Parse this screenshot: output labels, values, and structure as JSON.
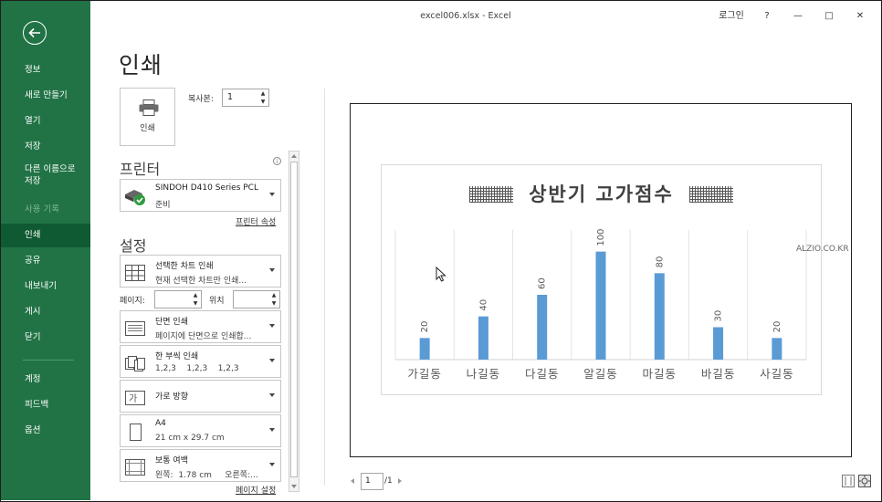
{
  "window": {
    "title": "excel006.xlsx  -  Excel",
    "signin_label": "로그인",
    "help_label": "?",
    "minimize_label": "—",
    "maximize_label": "□",
    "close_label": "✕"
  },
  "sidebar": {
    "items": [
      {
        "label": "정보"
      },
      {
        "label": "새로 만들기"
      },
      {
        "label": "열기"
      },
      {
        "label": "저장"
      },
      {
        "label": "다른 이름으로 저장"
      },
      {
        "label": "사용 기록"
      },
      {
        "label": "인쇄"
      },
      {
        "label": "공유"
      },
      {
        "label": "내보내기"
      },
      {
        "label": "게시"
      },
      {
        "label": "닫기"
      },
      {
        "label": "계정"
      },
      {
        "label": "피드백"
      },
      {
        "label": "옵션"
      }
    ],
    "active": "인쇄",
    "accent": "#217346"
  },
  "print": {
    "heading": "인쇄",
    "print_button_label": "인쇄",
    "copies_label": "복사본:",
    "copies_value": "1",
    "printer_section": "프린터",
    "printer_name": "SINDOH D410 Series PCL",
    "printer_status": "준비",
    "printer_properties_link": "프린터 속성",
    "settings_section": "설정",
    "settings": [
      {
        "line1": "선택한 차트 인쇄",
        "line2": "현재 선택한 차트만 인쇄..."
      },
      {
        "line1": "단면 인쇄",
        "line2": "페이지에 단면으로 인쇄합..."
      },
      {
        "line1": "한 부씩 인쇄",
        "line2": "1,2,3    1,2,3    1,2,3"
      },
      {
        "line1": "가로 방향",
        "line2": ""
      },
      {
        "line1": "A4",
        "line2": "21 cm x 29.7 cm"
      },
      {
        "line1": "보통 여백",
        "line2": "왼쪽:  1.78 cm     오른쪽:..."
      }
    ],
    "pages_label": "페이지:",
    "to_label": "위치",
    "page_setup_link": "페이지 설정"
  },
  "preview": {
    "current_page": "1",
    "total_pages": "/1",
    "watermark": "ALZIO.CO.KR"
  },
  "chart_data": {
    "type": "bar",
    "title": "상반기 고가점수",
    "categories": [
      "가길동",
      "나길동",
      "다길동",
      "알길동",
      "마길동",
      "바길동",
      "사길동"
    ],
    "values": [
      20,
      40,
      60,
      100,
      80,
      30,
      20
    ],
    "ylim": [
      0,
      120
    ],
    "bar_color": "#5b9bd5",
    "gridlines": "vertical",
    "data_labels": "rotated",
    "legend": "none"
  }
}
